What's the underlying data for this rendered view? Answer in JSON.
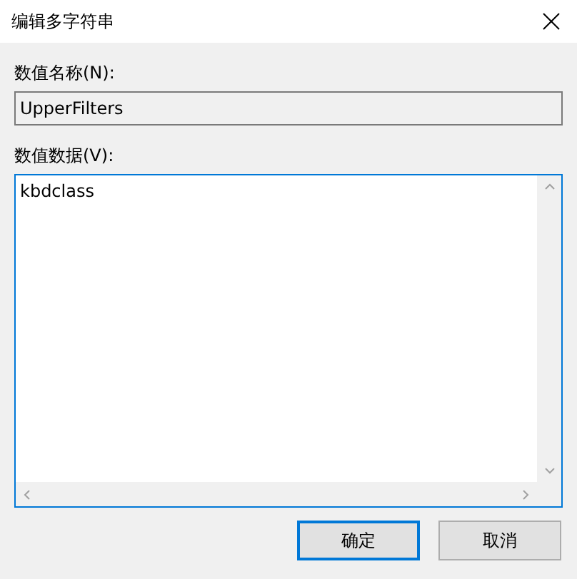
{
  "window": {
    "title": "编辑多字符串"
  },
  "value_name": {
    "label": "数值名称(N):",
    "value": "UpperFilters",
    "disabled": true
  },
  "value_data": {
    "label": "数值数据(V):",
    "value": "kbdclass",
    "focused": true
  },
  "buttons": [
    {
      "label": "确定",
      "default": true
    },
    {
      "label": "取消",
      "default": false
    }
  ]
}
